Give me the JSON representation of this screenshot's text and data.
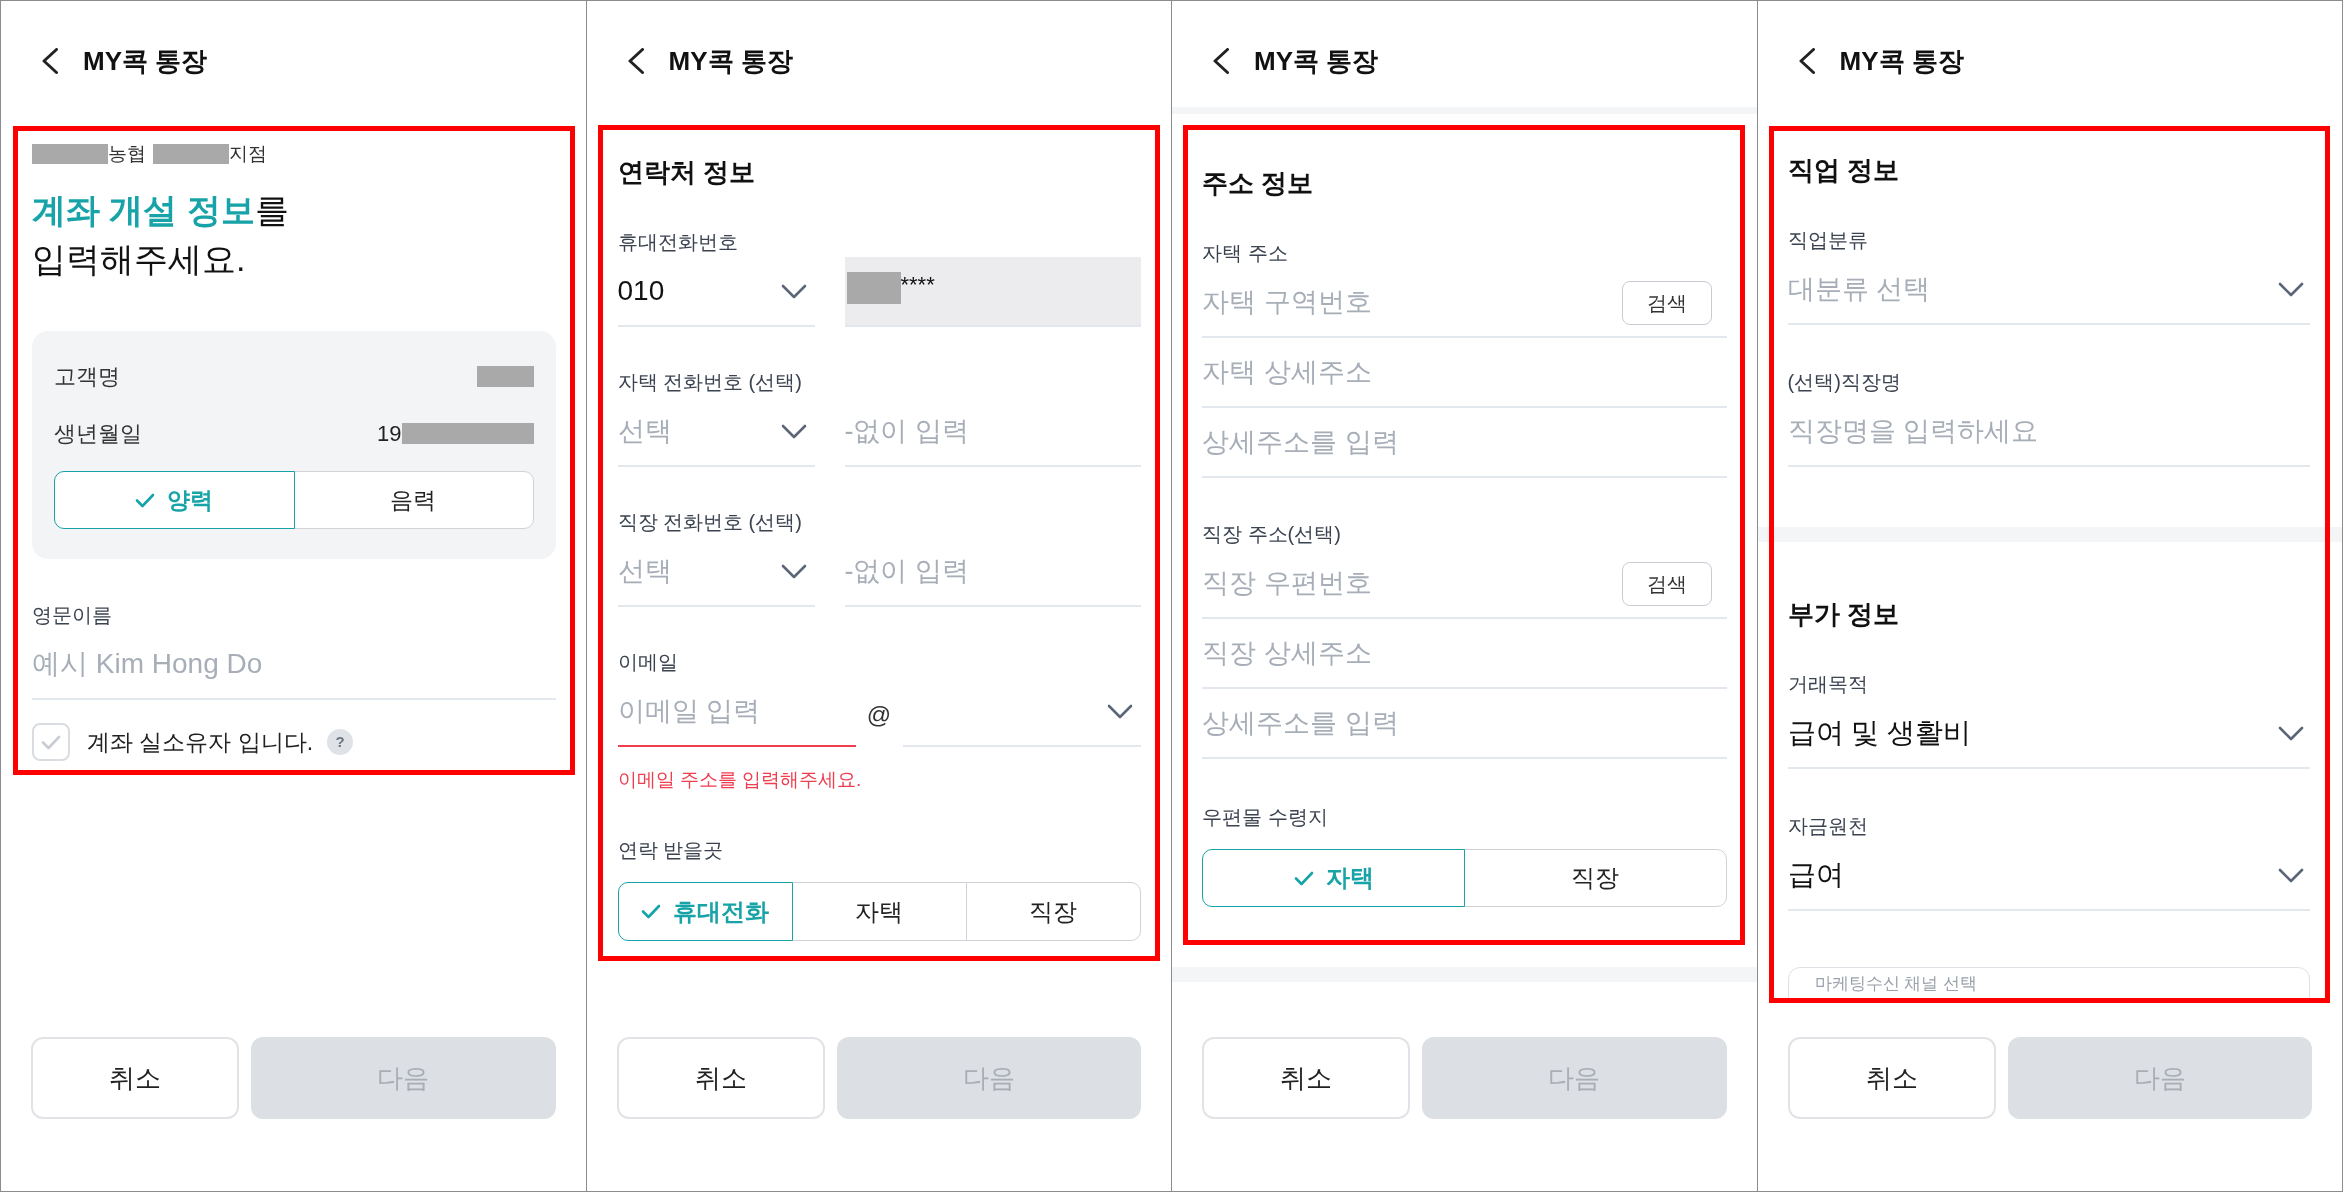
{
  "panels": [
    {
      "kind": "intro",
      "highlighted": true,
      "header": {
        "title": "MY콕 통장"
      },
      "branch_line": [
        {
          "text": "농협",
          "redacted_before": true
        },
        {
          "text": "지점",
          "redacted_before": true
        }
      ],
      "heading": {
        "accent": "계좌 개설 정보",
        "rest": "를",
        "second_line": "입력해주세요."
      },
      "info_card": {
        "rows": [
          {
            "label": "고객명",
            "value_redacted": true
          },
          {
            "label": "생년월일",
            "value": "19",
            "value_redacted": true
          }
        ],
        "calendar_options": [
          {
            "label": "양력",
            "selected": true
          },
          {
            "label": "음력",
            "selected": false
          }
        ]
      },
      "english_name": {
        "label": "영문이름",
        "placeholder": "예시 Kim Hong Do"
      },
      "owner_confirm": {
        "label": "계좌 실소유자 입니다.",
        "checked": false,
        "help": "?"
      },
      "buttons": [
        {
          "label": "취소",
          "kind": "secondary",
          "disabled": false
        },
        {
          "label": "다음",
          "kind": "primary",
          "disabled": true
        }
      ]
    },
    {
      "kind": "contact",
      "highlighted": true,
      "header": {
        "title": "MY콕 통장"
      },
      "section_title": "연락처 정보",
      "phone_rows": [
        {
          "label": "휴대전화번호",
          "area_code": {
            "value": "010"
          },
          "number": {
            "value": "****",
            "redacted_before": true,
            "readonly": true
          }
        },
        {
          "label": "자택 전화번호 (선택)",
          "area_code": {
            "placeholder": "선택"
          },
          "number": {
            "placeholder": "-없이 입력",
            "readonly": false
          }
        },
        {
          "label": "직장 전화번호 (선택)",
          "area_code": {
            "placeholder": "선택"
          },
          "number": {
            "placeholder": "-없이 입력",
            "readonly": false
          }
        }
      ],
      "email": {
        "label": "이메일",
        "placeholder": "이메일 입력",
        "at": "@",
        "invalid": true,
        "error": "이메일 주소를 입력해주세요."
      },
      "contact_place": {
        "label": "연락 받을곳",
        "options": [
          {
            "label": "휴대전화",
            "selected": true
          },
          {
            "label": "자택",
            "selected": false
          },
          {
            "label": "직장",
            "selected": false
          }
        ]
      },
      "buttons": [
        {
          "label": "취소",
          "kind": "secondary",
          "disabled": false
        },
        {
          "label": "다음",
          "kind": "primary",
          "disabled": true
        }
      ]
    },
    {
      "kind": "address",
      "highlighted": true,
      "header": {
        "title": "MY콕 통장"
      },
      "section_title": "주소 정보",
      "address_groups": [
        {
          "label": "자택 주소",
          "fields": [
            {
              "placeholder": "자택 구역번호",
              "search_button": "검색"
            },
            {
              "placeholder": "자택 상세주소"
            },
            {
              "placeholder": "상세주소를 입력"
            }
          ]
        },
        {
          "label": "직장 주소(선택)",
          "fields": [
            {
              "placeholder": "직장 우편번호",
              "search_button": "검색"
            },
            {
              "placeholder": "직장 상세주소"
            },
            {
              "placeholder": "상세주소를 입력"
            }
          ]
        }
      ],
      "mail_place": {
        "label": "우편물 수령지",
        "options": [
          {
            "label": "자택",
            "selected": true
          },
          {
            "label": "직장",
            "selected": false
          }
        ]
      },
      "buttons": [
        {
          "label": "취소",
          "kind": "secondary",
          "disabled": false
        },
        {
          "label": "다음",
          "kind": "primary",
          "disabled": true
        }
      ]
    },
    {
      "kind": "job",
      "highlighted": true,
      "header": {
        "title": "MY콕 통장"
      },
      "sections": [
        {
          "title": "직업 정보",
          "fields": [
            {
              "kind": "select",
              "label": "직업분류",
              "placeholder": "대분류 선택"
            },
            {
              "kind": "input",
              "label": "(선택)직장명",
              "placeholder": "직장명을 입력하세요"
            }
          ]
        },
        {
          "title": "부가 정보",
          "fields": [
            {
              "kind": "select",
              "label": "거래목적",
              "value": "급여 및 생활비"
            },
            {
              "kind": "select",
              "label": "자금원천",
              "value": "급여"
            }
          ]
        }
      ],
      "marketing_channel": {
        "placeholder": "마케팅수신 채널 선택"
      },
      "buttons": [
        {
          "label": "취소",
          "kind": "secondary",
          "disabled": false
        },
        {
          "label": "다음",
          "kind": "primary",
          "disabled": true
        }
      ]
    }
  ]
}
